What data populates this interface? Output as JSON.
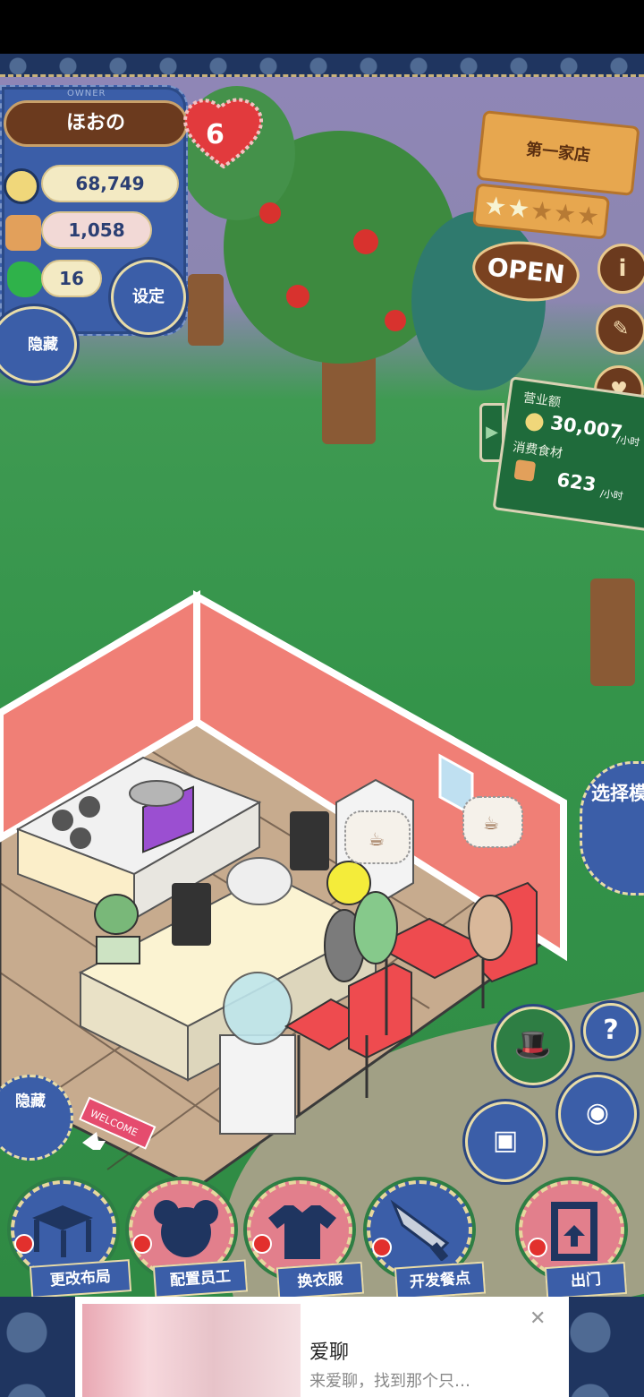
{
  "owner": {
    "label": "OWNER",
    "name": "ほおの",
    "level": "6"
  },
  "stats": {
    "money": "68,749",
    "food": "1,058",
    "clover": "16"
  },
  "buttons": {
    "settings": "设定",
    "hide_top": "隐藏",
    "hide_bottom": "隐藏",
    "select_mode": "选择模式"
  },
  "shop_sign": {
    "name": "第一家店",
    "stars_filled": 2,
    "stars_total": 5,
    "open": "OPEN"
  },
  "revenue_board": {
    "revenue_label": "营业额",
    "revenue_value": "30,007",
    "revenue_unit": "/小时",
    "food_label": "消费食材",
    "food_value": "623",
    "food_unit": "/小时"
  },
  "room": {
    "welcome_mat": "WELCOME"
  },
  "bottom_menu": [
    {
      "label": "更改布局"
    },
    {
      "label": "配置员工"
    },
    {
      "label": "换衣服"
    },
    {
      "label": "开发餐点"
    },
    {
      "label": "出门"
    }
  ],
  "ad": {
    "title": "爱聊",
    "subtitle": "来爱聊，找到那个只…",
    "close": "✕"
  },
  "colors": {
    "denim": "#3b5ea8",
    "wall": "#f07f76",
    "grass": "#34944a",
    "sign_wood": "#e7a74f"
  }
}
